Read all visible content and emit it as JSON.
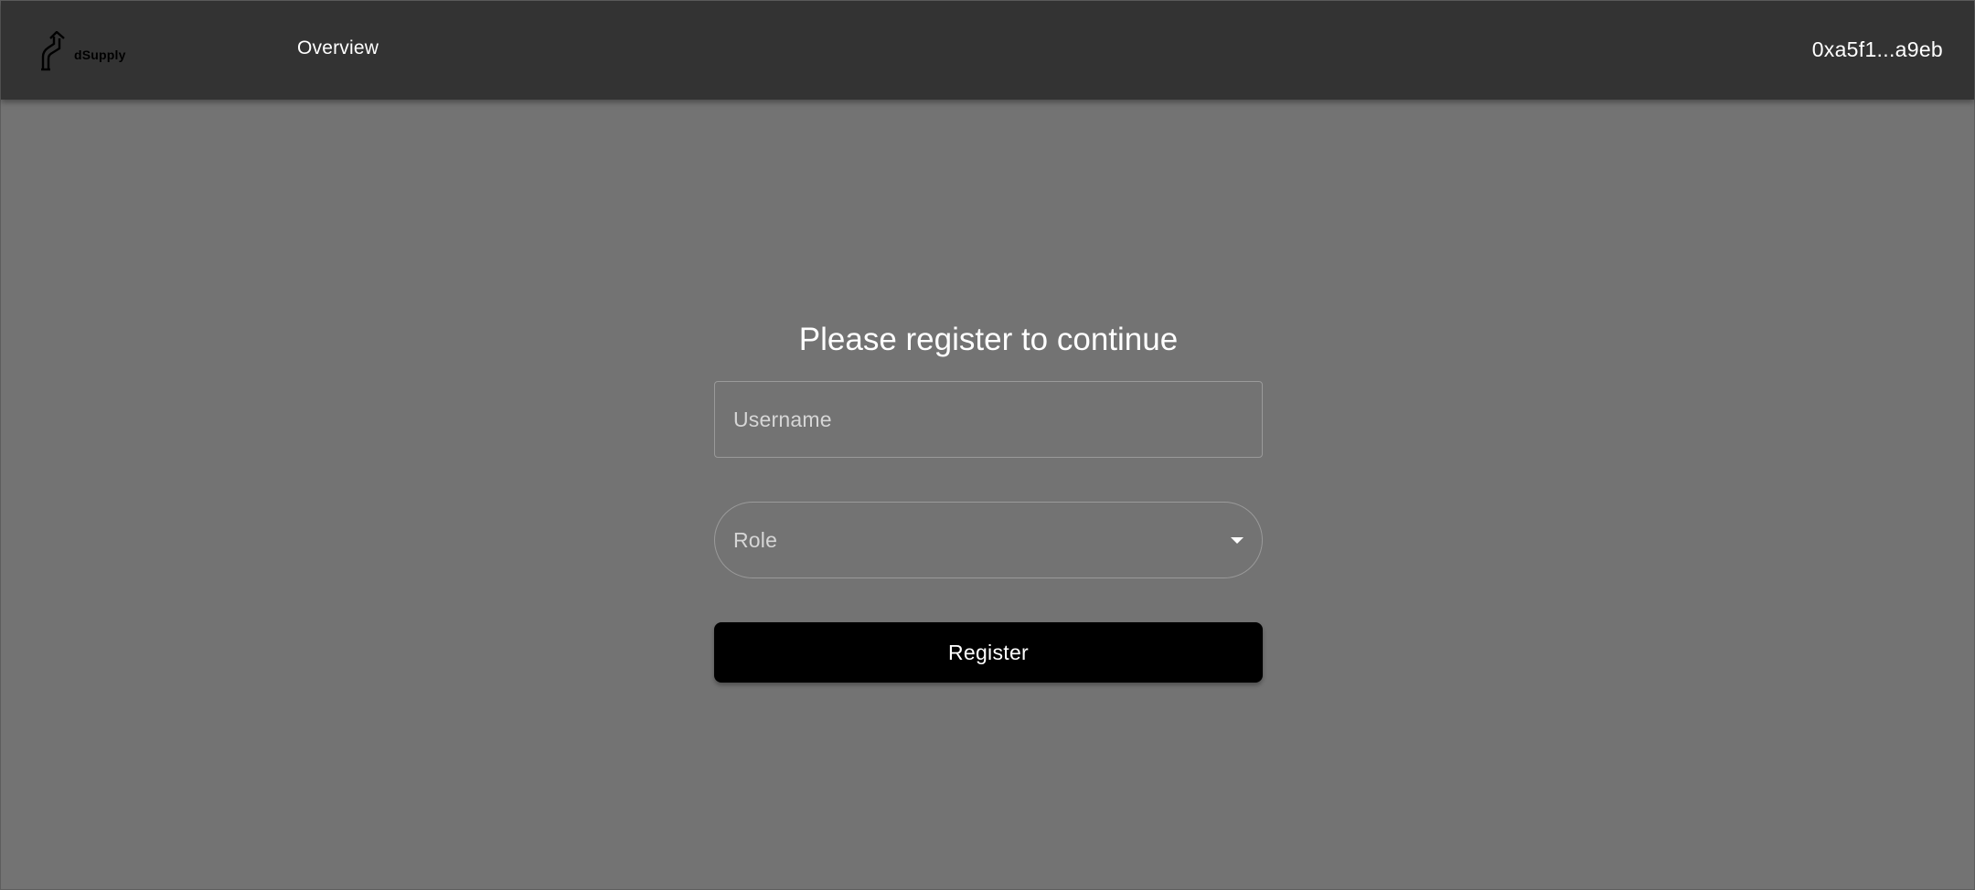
{
  "header": {
    "logo_text": "dSupply",
    "logo_icon": "upward-arrow-icon",
    "nav_overview": "Overview",
    "account_address": "0xa5f1...a9eb"
  },
  "register_form": {
    "title": "Please register to continue",
    "username_placeholder": "Username",
    "role_placeholder": "Role",
    "role_icon": "dropdown-caret-icon",
    "submit_label": "Register"
  },
  "colors": {
    "topbar_bg": "#333333",
    "page_bg": "#737373",
    "button_bg": "#000000",
    "text": "#ffffff"
  }
}
